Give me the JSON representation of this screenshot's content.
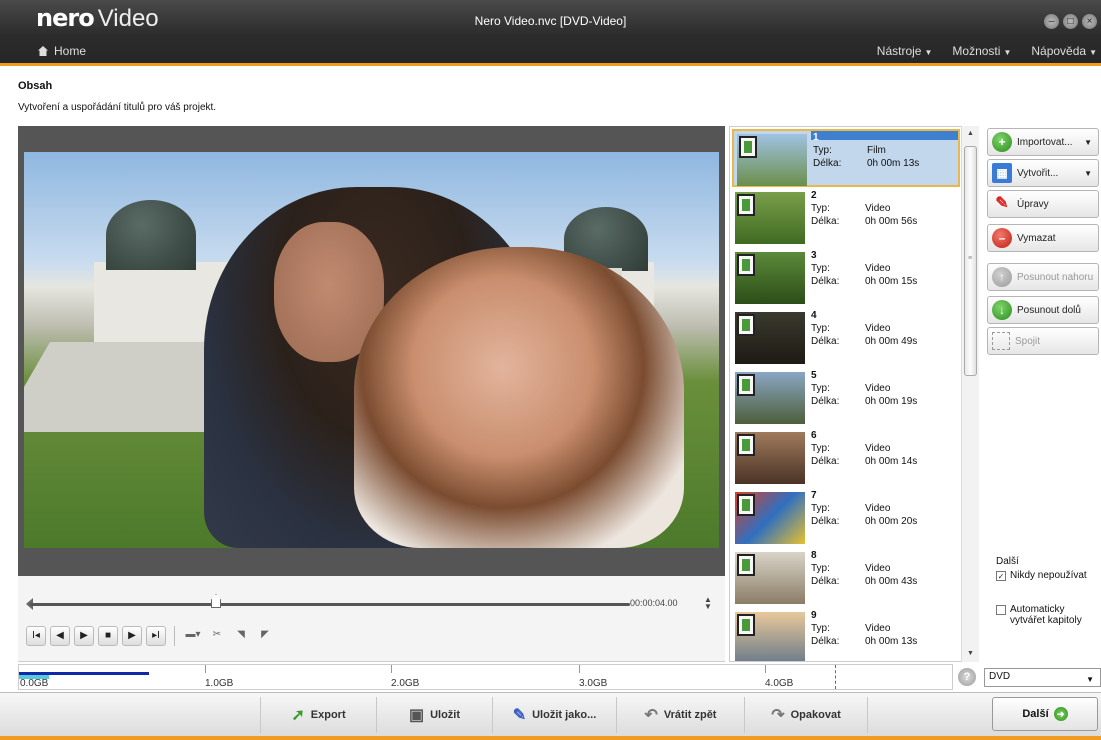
{
  "app": {
    "logo_brand": "nero",
    "logo_product": "Video",
    "window_title": "Nero Video.nvc [DVD-Video]",
    "home_label": "Home",
    "menus": [
      "Nástroje",
      "Možnosti",
      "Nápověda"
    ]
  },
  "page": {
    "heading": "Obsah",
    "subheading": "Vytvoření a uspořádání titulů pro váš projekt."
  },
  "player": {
    "timecode": "00:00:04.00",
    "position_fraction": 0.31
  },
  "titles": {
    "type_label": "Typ:",
    "length_label": "Délka:",
    "items": [
      {
        "num": "1",
        "type": "Film",
        "length": "0h 00m 13s",
        "selected": true
      },
      {
        "num": "2",
        "type": "Video",
        "length": "0h 00m 56s"
      },
      {
        "num": "3",
        "type": "Video",
        "length": "0h 00m 15s"
      },
      {
        "num": "4",
        "type": "Video",
        "length": "0h 00m 49s"
      },
      {
        "num": "5",
        "type": "Video",
        "length": "0h 00m 19s"
      },
      {
        "num": "6",
        "type": "Video",
        "length": "0h 00m 14s"
      },
      {
        "num": "7",
        "type": "Video",
        "length": "0h 00m 20s"
      },
      {
        "num": "8",
        "type": "Video",
        "length": "0h 00m 43s"
      },
      {
        "num": "9",
        "type": "Video",
        "length": "0h 00m 13s"
      }
    ]
  },
  "actions": {
    "import": "Importovat...",
    "create": "Vytvořit...",
    "edit": "Úpravy",
    "delete": "Vymazat",
    "move_up": "Posunout nahoru",
    "move_down": "Posunout dolů",
    "merge": "Spojit"
  },
  "options": {
    "title": "Další",
    "never_use": "Nikdy nepoužívat",
    "never_use_checked": true,
    "auto_chapters": "Automaticky vytvářet kapitoly",
    "auto_chapters_checked": false
  },
  "capacity": {
    "labels": [
      "0.0GB",
      "1.0GB",
      "2.0GB",
      "3.0GB",
      "4.0GB"
    ],
    "disc_type": "DVD"
  },
  "toolbar": {
    "export": "Export",
    "save": "Uložit",
    "save_as": "Uložit jako...",
    "undo": "Vrátit zpět",
    "redo": "Opakovat",
    "next": "Další"
  },
  "colors": {
    "accent_orange": "#f29b22",
    "selection_blue": "#3f7fd0",
    "capacity_blue": "#0f2aa8"
  }
}
